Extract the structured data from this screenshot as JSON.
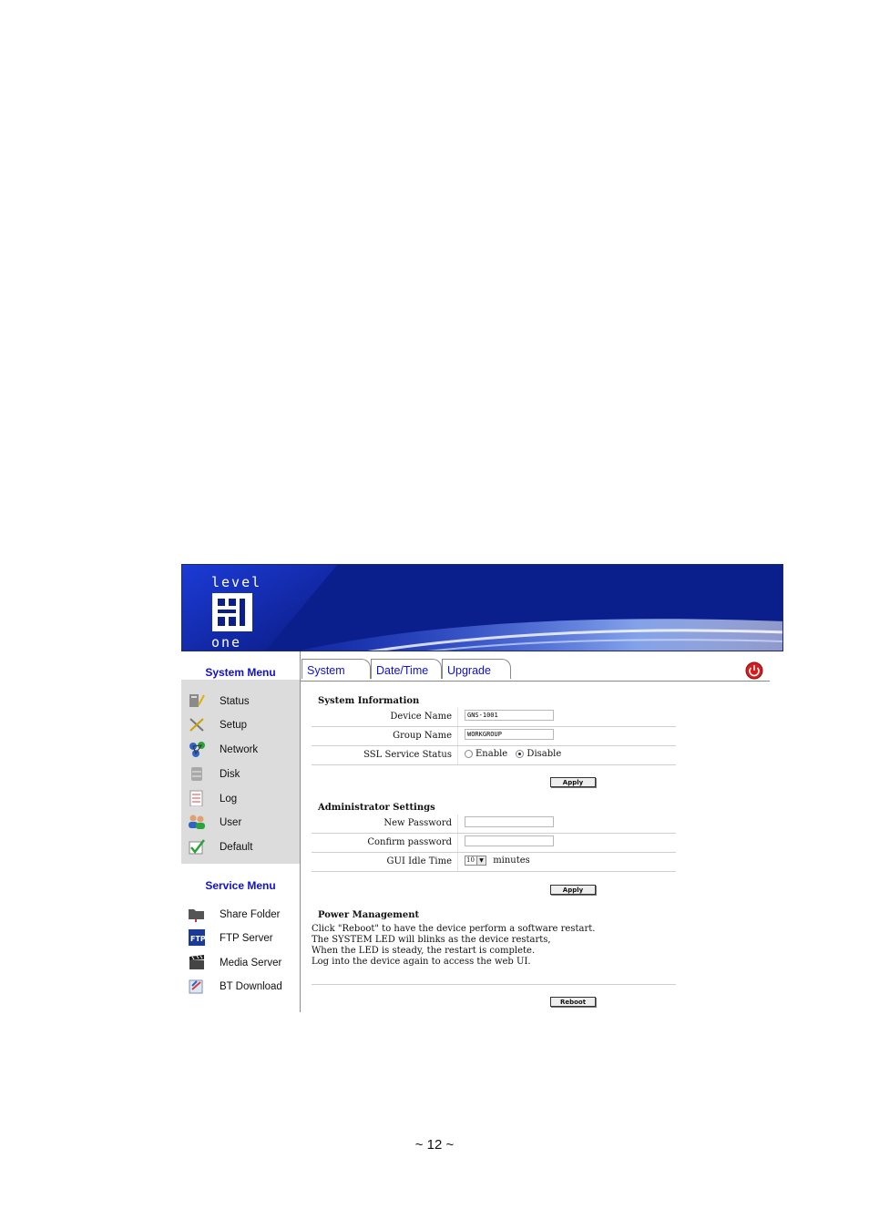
{
  "banner": {
    "logo_top": "level",
    "logo_bottom": "one"
  },
  "sidebar": {
    "system_title": "System Menu",
    "system_items": [
      {
        "label": "Status",
        "icon": "status-icon"
      },
      {
        "label": "Setup",
        "icon": "setup-icon"
      },
      {
        "label": "Network",
        "icon": "network-icon"
      },
      {
        "label": "Disk",
        "icon": "disk-icon"
      },
      {
        "label": "Log",
        "icon": "log-icon"
      },
      {
        "label": "User",
        "icon": "user-icon"
      },
      {
        "label": "Default",
        "icon": "default-icon"
      }
    ],
    "service_title": "Service Menu",
    "service_items": [
      {
        "label": "Share Folder",
        "icon": "folder-icon"
      },
      {
        "label": "FTP Server",
        "icon": "ftp-icon"
      },
      {
        "label": "Media Server",
        "icon": "media-icon"
      },
      {
        "label": "BT Download",
        "icon": "bt-download-icon"
      }
    ]
  },
  "tabs": [
    "System",
    "Date/Time",
    "Upgrade"
  ],
  "system_info": {
    "title": "System Information",
    "device_name_label": "Device Name",
    "device_name_value": "GNS-1001",
    "group_name_label": "Group Name",
    "group_name_value": "WORKGROUP",
    "ssl_label": "SSL Service Status",
    "ssl_enable": "Enable",
    "ssl_disable": "Disable",
    "ssl_selected": "Disable",
    "apply": "Apply"
  },
  "admin": {
    "title": "Administrator Settings",
    "new_password_label": "New Password",
    "confirm_password_label": "Confirm password",
    "idle_label": "GUI Idle Time",
    "idle_value": "10",
    "idle_unit": "minutes",
    "apply": "Apply"
  },
  "power": {
    "title": "Power Management",
    "lines": [
      "Click \"Reboot\" to have the device perform a software restart.",
      "The SYSTEM LED will blinks as the device restarts,",
      "When the LED is steady, the restart is complete.",
      "Log into the device again to access the web UI."
    ],
    "reboot": "Reboot"
  },
  "page_number": "~ 12 ~",
  "colors": {
    "banner": "#0b1f8c",
    "menu_title": "#1010d0",
    "menu_bg": "#dcdcdc",
    "power_button": "#d81c1c"
  }
}
